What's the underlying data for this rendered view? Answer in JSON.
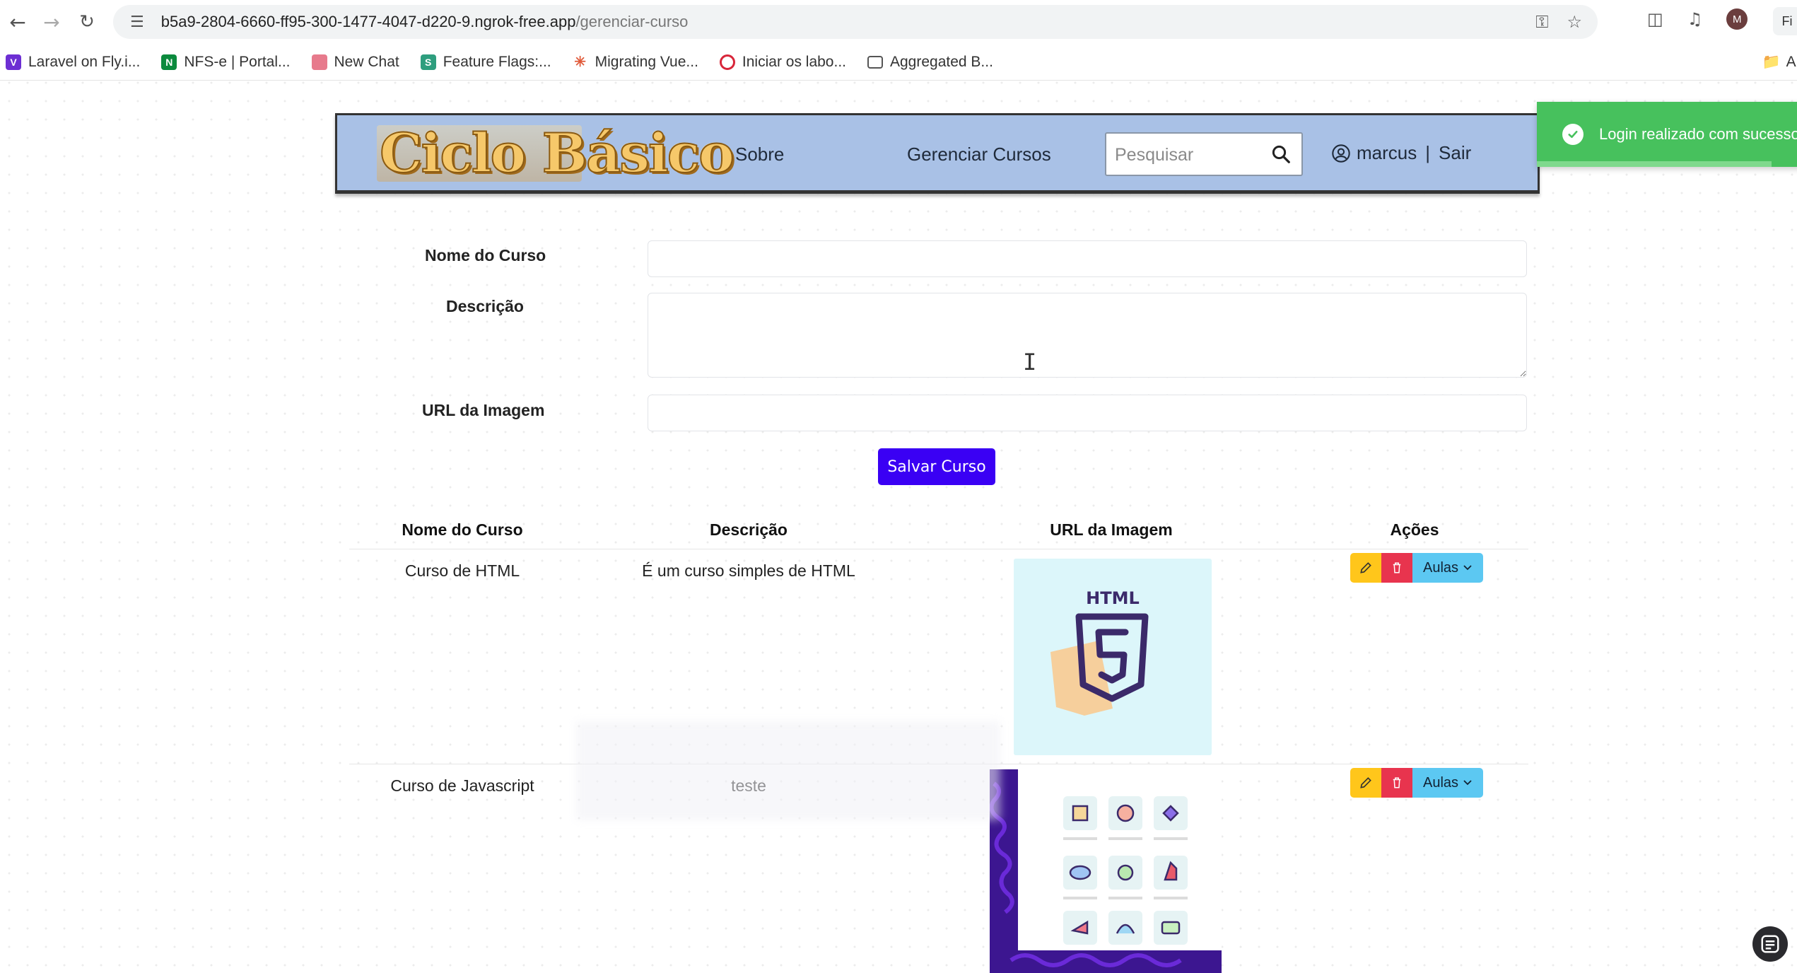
{
  "browser": {
    "url_host": "b5a9-2804-6660-ff95-300-1477-4047-d220-9.ngrok-free.app",
    "url_path": "/gerenciar-curso",
    "profile_initial": "M",
    "edge_text": "Fi",
    "bookmarks": [
      {
        "label": "Laravel on Fly.i...",
        "icon": "laravel-icon",
        "color": "#6d2fd3"
      },
      {
        "label": "NFS-e | Portal...",
        "icon": "nfse-icon",
        "color": "#0b8a3d"
      },
      {
        "label": "New Chat",
        "icon": "chat-icon",
        "color": "#e77a8c"
      },
      {
        "label": "Feature Flags:...",
        "icon": "flags-icon",
        "color": "#2e9e7e"
      },
      {
        "label": "Migrating Vue...",
        "icon": "asterisk-icon",
        "color": "#e05a3a"
      },
      {
        "label": "Iniciar os labo...",
        "icon": "lab-icon",
        "color": "#d8263a"
      },
      {
        "label": "Aggregated B...",
        "icon": "folder-icon",
        "color": "#555555"
      }
    ],
    "all_bookmarks_label": "All"
  },
  "header": {
    "logo_text": "Ciclo Básico",
    "nav": {
      "sobre": "Sobre",
      "gerenciar": "Gerenciar Cursos"
    },
    "search_placeholder": "Pesquisar",
    "username": "marcus",
    "separator": "|",
    "logout": "Sair",
    "bg_color": "#a9c1e6"
  },
  "toast": {
    "message": "Login realizado com sucesso",
    "color": "#47c15d",
    "progress": 0.83
  },
  "form": {
    "name_label": "Nome do Curso",
    "name_value": "",
    "desc_label": "Descrição",
    "desc_value": "",
    "image_label": "URL da Imagem",
    "image_value": "",
    "save_label": "Salvar Curso",
    "save_color": "#3a00f4"
  },
  "table": {
    "headers": {
      "name": "Nome do Curso",
      "desc": "Descrição",
      "image": "URL da Imagem",
      "actions": "Ações"
    },
    "rows": [
      {
        "name": "Curso de HTML",
        "desc": "É um curso simples de HTML",
        "image_text": "HTML"
      },
      {
        "name": "Curso de Javascript",
        "desc": "teste",
        "image_text": ""
      }
    ],
    "aulas_label": "Aulas"
  }
}
